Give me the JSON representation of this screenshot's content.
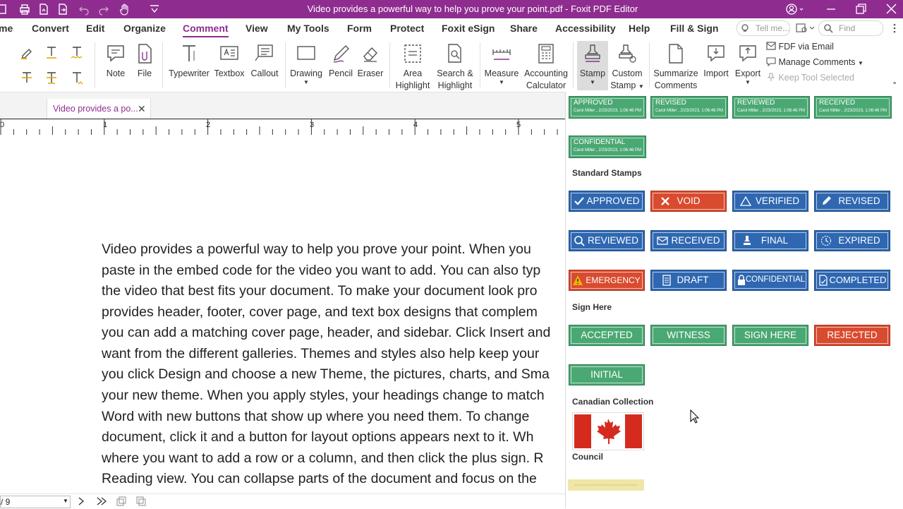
{
  "title_bar": {
    "title": "Video provides a powerful way to help you prove your point.pdf - Foxit PDF Editor",
    "quick_access_icons": [
      "sidebar-icon",
      "print-icon",
      "new-file-icon",
      "open-file-icon",
      "undo-icon",
      "redo-icon",
      "hand-tool-icon",
      "customize-dropdown-icon"
    ],
    "window_controls": [
      "account-icon",
      "minimize-icon",
      "restore-icon",
      "close-icon"
    ]
  },
  "menu": {
    "items": [
      "me",
      "Convert",
      "Edit",
      "Organize",
      "Comment",
      "View",
      "My Tools",
      "Form",
      "Protect",
      "Foxit eSign",
      "Share",
      "Accessibility",
      "Help",
      "Fill & Sign"
    ],
    "active": "Comment",
    "tell_me_placeholder": "Tell me...",
    "find_placeholder": "Find"
  },
  "ribbon": {
    "note": "Note",
    "file": "File",
    "typewriter": "Typewriter",
    "textbox": "Textbox",
    "callout": "Callout",
    "drawing": "Drawing",
    "pencil": "Pencil",
    "eraser": "Eraser",
    "area_highlight_1": "Area",
    "area_highlight_2": "Highlight",
    "search_highlight_1": "Search &",
    "search_highlight_2": "Highlight",
    "measure": "Measure",
    "accounting_1": "Accounting",
    "accounting_2": "Calculator",
    "stamp": "Stamp",
    "custom_stamp_1": "Custom",
    "custom_stamp_2": "Stamp",
    "summarize_1": "Summarize",
    "summarize_2": "Comments",
    "import": "Import",
    "export": "Export",
    "fdf_email": "FDF via Email",
    "manage_comments": "Manage Comments",
    "keep_tool": "Keep Tool Selected"
  },
  "document": {
    "tab_label": "Video provides a po...",
    "ruler_marks": [
      "0",
      "1",
      "2",
      "3",
      "4",
      "5"
    ],
    "lines": [
      "Video provides a powerful way to help you prove your point. When you",
      "paste in the embed code for the video you want to add. You can also typ",
      "the video that best fits your document. To make your document look pro",
      "provides header, footer, cover page, and text box designs that complem",
      "you can add a matching cover page, header, and sidebar. Click Insert and",
      "want from the different galleries. Themes and styles also help keep your",
      "you click Design and choose a new Theme, the pictures, charts, and Sma",
      "your new theme. When you apply styles, your headings change to match",
      "Word with new buttons that show up where you need them. To change",
      "document, click it and a button for layout options appears next to it. Wh",
      "where you want to add a row or a column, and then click the plus sign. R",
      "Reading view. You can collapse parts of the document and focus on the"
    ]
  },
  "status_bar": {
    "page": "/ 9"
  },
  "stamps": {
    "dynamic": [
      {
        "title": "APPROVED",
        "sub": "Carol Miller , 2/23/2023, 1:06:46 PM"
      },
      {
        "title": "REVISED",
        "sub": "Carol Miller , 2/23/2023, 1:06:46 PM"
      },
      {
        "title": "REVIEWED",
        "sub": "Carol Miller , 2/23/2023, 1:06:46 PM"
      },
      {
        "title": "RECEIVED",
        "sub": "Carol Miller , 2/23/2023, 1:06:46 PM"
      },
      {
        "title": "CONFIDENTIAL",
        "sub": "Carol Miller , 2/23/2023, 1:06:46 PM"
      }
    ],
    "standard_heading": "Standard Stamps",
    "standard": [
      "APPROVED",
      "VOID",
      "VERIFIED",
      "REVISED",
      "REVIEWED",
      "RECEIVED",
      "FINAL",
      "EXPIRED",
      "EMERGENCY",
      "DRAFT",
      "CONFIDENTIAL",
      "COMPLETED"
    ],
    "sign_heading": "Sign Here",
    "sign": [
      "ACCEPTED",
      "WITNESS",
      "SIGN HERE",
      "REJECTED",
      "INITIAL"
    ],
    "canadian_heading": "Canadian Collection",
    "council_heading": "Council",
    "colors": {
      "brand": "#8e2d8f",
      "blue": "#2f67b1",
      "red": "#d94b2f",
      "green": "#4aa873"
    }
  }
}
